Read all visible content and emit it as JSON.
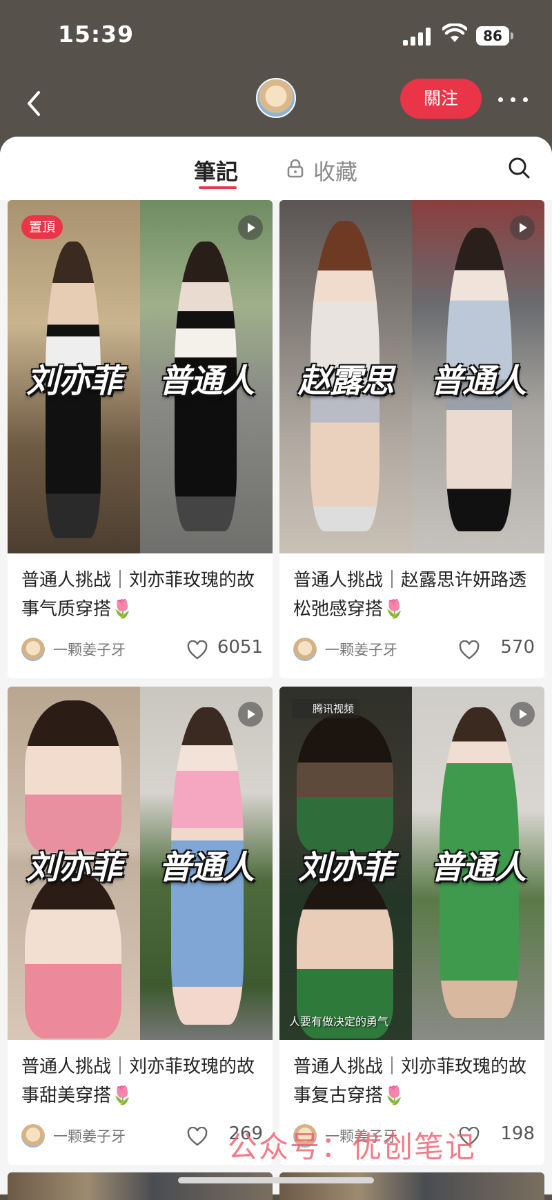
{
  "status_bar": {
    "time": "15:39",
    "battery": "86"
  },
  "header": {
    "follow_label": "關注"
  },
  "tabs": {
    "notes": "筆記",
    "favorites": "收藏"
  },
  "pinned_label": "置頂",
  "cards": [
    {
      "caption": "普通人挑战｜刘亦菲玫瑰的故事气质穿搭🌷",
      "author": "一颗姜子牙",
      "likes": "6051",
      "left_overlay": "刘亦菲",
      "right_overlay": "普通人"
    },
    {
      "caption": "普通人挑战｜赵露思许妍路透松弛感穿搭🌷",
      "author": "一颗姜子牙",
      "likes": "570",
      "left_overlay": "赵露思",
      "right_overlay": "普通人"
    },
    {
      "caption": "普通人挑战｜刘亦菲玫瑰的故事甜美穿搭🌷",
      "author": "一颗姜子牙",
      "likes": "269",
      "left_overlay": "刘亦菲",
      "right_overlay": "普通人"
    },
    {
      "caption": "普通人挑战｜刘亦菲玫瑰的故事复古穿搭🌷",
      "author": "一颗姜子牙",
      "likes": "198",
      "left_overlay": "刘亦菲",
      "right_overlay": "普通人",
      "video_logo": "腾讯视频",
      "video_subtitle": "人要有做决定的勇气"
    }
  ],
  "watermark": "公众号：优创笔记",
  "colors": {
    "accent": "#ea3447",
    "header_bg": "#56524b",
    "sheet_bg": "#f5f5f5"
  }
}
